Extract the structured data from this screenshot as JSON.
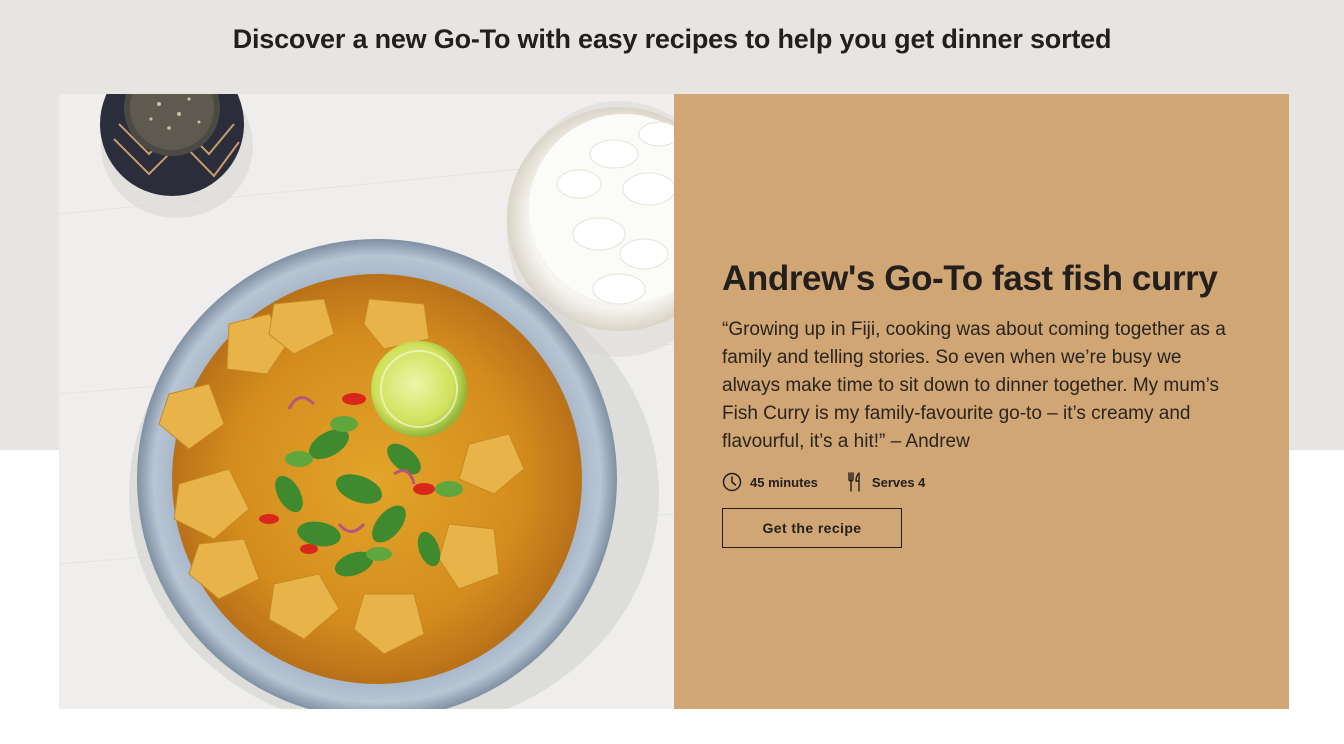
{
  "section": {
    "headline": "Discover a new Go-To with easy recipes to help you get dinner sorted",
    "band_color": "#e6e5e2"
  },
  "feature": {
    "image": {
      "description_icon": "curry-bowl-photo",
      "alt": "Andrew's Go-To fast fish curry"
    },
    "panel_color": "#cfa674",
    "title": "Andrew's Go-To fast fish curry",
    "quote": "“Growing up in Fiji, cooking was about coming together as a family and telling stories. So even when we’re busy we always make time to sit down to dinner together. My mum’s Fish Curry is my family-favourite go-to – it’s creamy and flavourful, it’s a hit!” – Andrew",
    "meta": {
      "time_icon": "clock-icon",
      "time_label": "45 minutes",
      "serves_icon": "fork-knife-icon",
      "serves_label": "Serves 4"
    },
    "cta_label": "Get the recipe"
  }
}
